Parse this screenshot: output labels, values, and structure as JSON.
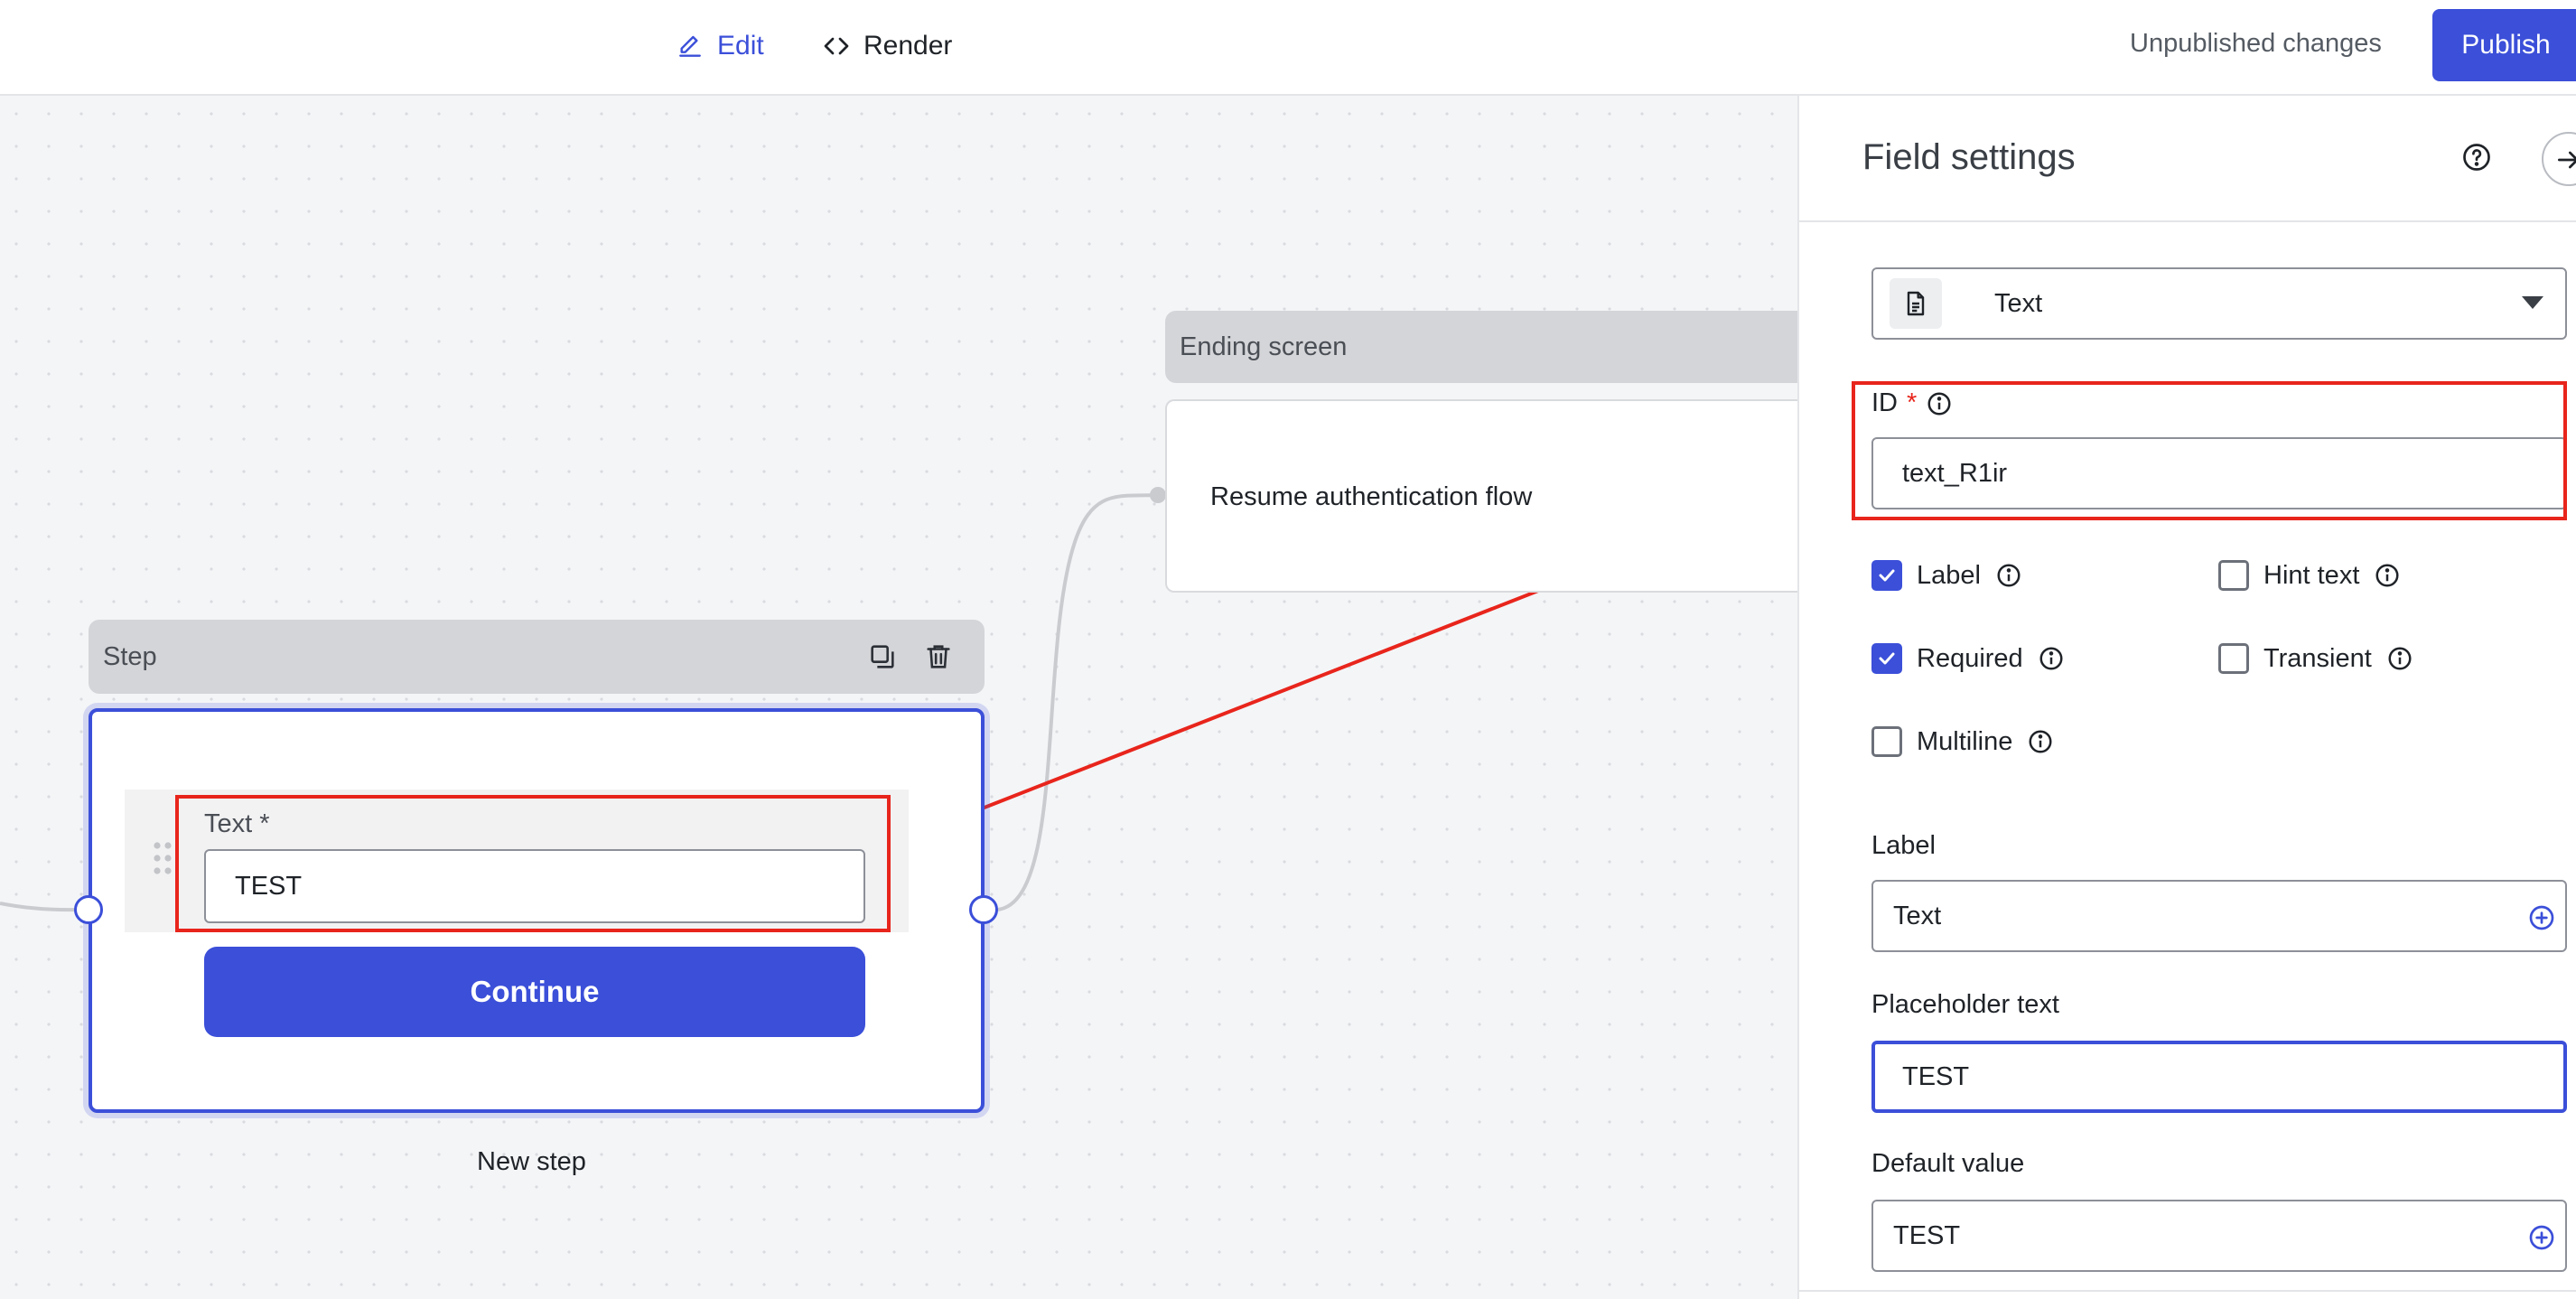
{
  "topbar": {
    "edit_label": "Edit",
    "render_label": "Render",
    "status": "Unpublished changes",
    "publish_label": "Publish"
  },
  "canvas": {
    "ending": {
      "header": "Ending screen",
      "body": "Resume authentication flow"
    },
    "step": {
      "header": "Step",
      "field_label": "Text *",
      "field_value": "TEST",
      "button_label": "Continue",
      "caption": "New step"
    }
  },
  "panel": {
    "title": "Field settings",
    "type_value": "Text",
    "id_label": "ID",
    "id_required_mark": "*",
    "id_value": "text_R1ir",
    "checkboxes": [
      {
        "label": "Label",
        "checked": true
      },
      {
        "label": "Hint text",
        "checked": false
      },
      {
        "label": "Required",
        "checked": true
      },
      {
        "label": "Transient",
        "checked": false
      },
      {
        "label": "Multiline",
        "checked": false
      }
    ],
    "label_title": "Label",
    "label_value": "Text",
    "placeholder_title": "Placeholder text",
    "placeholder_value": "TEST",
    "default_title": "Default value",
    "default_value": "TEST"
  },
  "colors": {
    "accent": "#3b4fd9",
    "annotation": "#e8251c",
    "header_gray": "#d4d5d8"
  },
  "icons": [
    "pencil-icon",
    "code-icon",
    "copy-icon",
    "trash-icon",
    "document-icon",
    "caret-down-icon",
    "help-icon",
    "arrow-right-icon",
    "info-icon",
    "check-icon",
    "plus-circle-icon",
    "drag-handle-icon"
  ]
}
